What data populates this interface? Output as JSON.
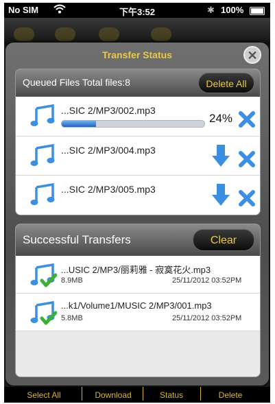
{
  "status_bar": {
    "carrier": "No SIM",
    "time": "下午3:52",
    "battery": "100%"
  },
  "modal": {
    "title": "Transfer Status",
    "close_icon": "close-circle-icon"
  },
  "queued": {
    "header": "Queued Files Total files:8",
    "delete_all_label": "Delete All",
    "items": [
      {
        "name": "...SIC 2/MP3/002.mp3",
        "progress_percent": 24,
        "progress_label": "24%"
      },
      {
        "name": "...SIC 2/MP3/004.mp3"
      },
      {
        "name": "...SIC 2/MP3/005.mp3"
      }
    ]
  },
  "successful": {
    "header": "Successful Transfers",
    "clear_label": "Clear",
    "items": [
      {
        "name": "...USIC 2/MP3/丽莉雅 - 寂寞花火.mp3",
        "size": "8.9MB",
        "date": "25/11/2012 03:52PM"
      },
      {
        "name": "...k1/Volume1/MUSIC 2/MP3/001.mp3",
        "size": "5.8MB",
        "date": "25/11/2012 03:52PM"
      }
    ]
  },
  "tabbar": {
    "select_all": "Select All",
    "download": "Download",
    "status": "Status",
    "delete": "Delete"
  },
  "colors": {
    "accent": "#e8c94a",
    "progress": "#2f74c8",
    "icon_blue": "#3b8fe0",
    "check_green": "#3cb034"
  }
}
